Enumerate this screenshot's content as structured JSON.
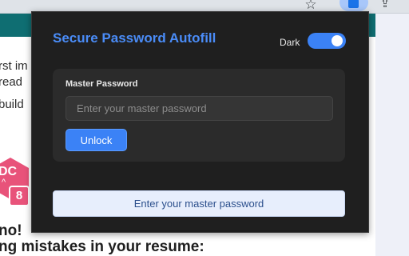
{
  "browser": {
    "icons": [
      "star-icon",
      "extensions-puzzle-icon",
      "share-icon"
    ]
  },
  "background_page": {
    "line1": "rst im",
    "line2": "read",
    "line3": "build",
    "hex_badge_text": "DC",
    "hex_badge_caret": "^",
    "number_badge": "8",
    "heading1": "no!",
    "heading2": "ng mistakes in your resume:"
  },
  "popup": {
    "title": "Secure Password Autofill",
    "theme_label": "Dark",
    "theme_toggle_on": true,
    "field_label": "Master Password",
    "password_placeholder": "Enter your master password",
    "password_value": "",
    "unlock_label": "Unlock",
    "status_message": "Enter your master password"
  },
  "colors": {
    "popup_bg": "#1f1f1f",
    "accent": "#3b82f6",
    "title": "#4a8cf7",
    "card_bg": "#2b2b2b",
    "status_bg": "#e7eefc",
    "page_teal": "#0f6e72"
  }
}
